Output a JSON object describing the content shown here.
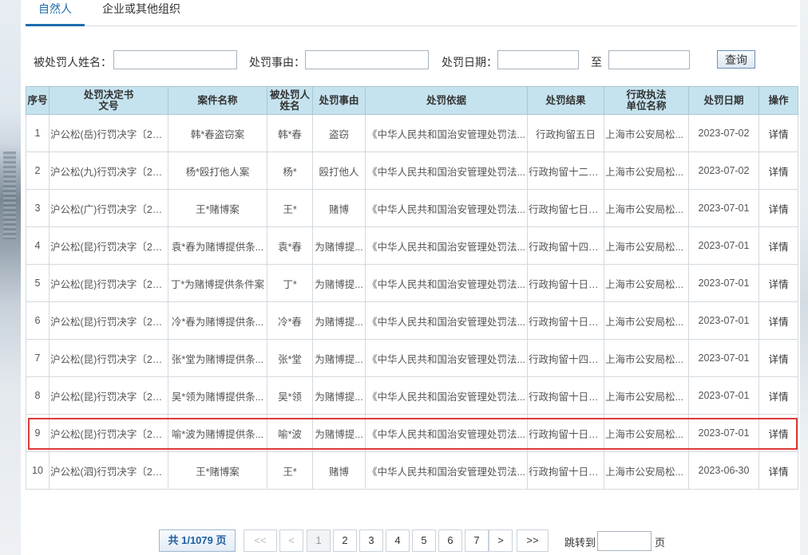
{
  "tabs": [
    {
      "label": "自然人",
      "active": true
    },
    {
      "label": "企业或其他组织",
      "active": false
    }
  ],
  "search": {
    "name_label": "被处罚人姓名：",
    "name_value": "",
    "reason_label": "处罚事由：",
    "reason_value": "",
    "date_label": "处罚日期：",
    "date_from": "",
    "to_label": "至",
    "date_to": "",
    "query_label": "查询"
  },
  "table": {
    "headers": {
      "seq": "序号",
      "doc_no_1": "处罚决定书",
      "doc_no_2": "文号",
      "case_name": "案件名称",
      "person_1": "被处罚人",
      "person_2": "姓名",
      "reason": "处罚事由",
      "basis": "处罚依据",
      "result": "处罚结果",
      "agency_1": "行政执法",
      "agency_2": "单位名称",
      "date": "处罚日期",
      "op": "操作"
    },
    "rows": [
      {
        "seq": "1",
        "doc_no": "沪公松(岳)行罚决字〔202...",
        "case_name": "韩*春盗窃案",
        "person": "韩*春",
        "reason": "盗窃",
        "basis": "《中华人民共和国治安管理处罚法...",
        "result": "行政拘留五日",
        "agency": "上海市公安局松...",
        "date": "2023-07-02",
        "op": "详情"
      },
      {
        "seq": "2",
        "doc_no": "沪公松(九)行罚决字〔202...",
        "case_name": "杨*殴打他人案",
        "person": "杨*",
        "reason": "殴打他人",
        "basis": "《中华人民共和国治安管理处罚法...",
        "result": "行政拘留十二日...",
        "agency": "上海市公安局松...",
        "date": "2023-07-02",
        "op": "详情"
      },
      {
        "seq": "3",
        "doc_no": "沪公松(广)行罚决字〔202...",
        "case_name": "王*赌博案",
        "person": "王*",
        "reason": "赌博",
        "basis": "《中华人民共和国治安管理处罚法...",
        "result": "行政拘留七日并...",
        "agency": "上海市公安局松...",
        "date": "2023-07-01",
        "op": "详情"
      },
      {
        "seq": "4",
        "doc_no": "沪公松(昆)行罚决字〔202...",
        "case_name": "袁*春为赌博提供条...",
        "person": "袁*春",
        "reason": "为赌博提...",
        "basis": "《中华人民共和国治安管理处罚法...",
        "result": "行政拘留十四日...",
        "agency": "上海市公安局松...",
        "date": "2023-07-01",
        "op": "详情"
      },
      {
        "seq": "5",
        "doc_no": "沪公松(昆)行罚决字〔202...",
        "case_name": "丁*为赌博提供条件案",
        "person": "丁*",
        "reason": "为赌博提...",
        "basis": "《中华人民共和国治安管理处罚法...",
        "result": "行政拘留十日并...",
        "agency": "上海市公安局松...",
        "date": "2023-07-01",
        "op": "详情"
      },
      {
        "seq": "6",
        "doc_no": "沪公松(昆)行罚决字〔202...",
        "case_name": "冷*春为赌博提供条...",
        "person": "冷*春",
        "reason": "为赌博提...",
        "basis": "《中华人民共和国治安管理处罚法...",
        "result": "行政拘留十日并...",
        "agency": "上海市公安局松...",
        "date": "2023-07-01",
        "op": "详情"
      },
      {
        "seq": "7",
        "doc_no": "沪公松(昆)行罚决字〔202...",
        "case_name": "张*堂为赌博提供条...",
        "person": "张*堂",
        "reason": "为赌博提...",
        "basis": "《中华人民共和国治安管理处罚法...",
        "result": "行政拘留十四日...",
        "agency": "上海市公安局松...",
        "date": "2023-07-01",
        "op": "详情"
      },
      {
        "seq": "8",
        "doc_no": "沪公松(昆)行罚决字〔202...",
        "case_name": "吴*领为赌博提供条...",
        "person": "吴*领",
        "reason": "为赌博提...",
        "basis": "《中华人民共和国治安管理处罚法...",
        "result": "行政拘留十日并...",
        "agency": "上海市公安局松...",
        "date": "2023-07-01",
        "op": "详情"
      },
      {
        "seq": "9",
        "doc_no": "沪公松(昆)行罚决字〔202...",
        "case_name": "喻*波为赌博提供条...",
        "person": "喻*波",
        "reason": "为赌博提...",
        "basis": "《中华人民共和国治安管理处罚法...",
        "result": "行政拘留十日并...",
        "agency": "上海市公安局松...",
        "date": "2023-07-01",
        "op": "详情"
      },
      {
        "seq": "10",
        "doc_no": "沪公松(泗)行罚决字〔202...",
        "case_name": "王*赌博案",
        "person": "王*",
        "reason": "赌博",
        "basis": "《中华人民共和国治安管理处罚法...",
        "result": "行政拘留十日并...",
        "agency": "上海市公安局松...",
        "date": "2023-06-30",
        "op": "详情"
      }
    ]
  },
  "highlight_color": "#e03a3a",
  "accent_color": "#1f6cb0",
  "header_bg_color": "#c5e3ee",
  "pager": {
    "total_label": "共 1/1079 页",
    "first": "<<",
    "prev": "<",
    "pages": [
      "1",
      "2",
      "3",
      "4",
      "5",
      "6",
      "7"
    ],
    "current_page": "1",
    "next": ">",
    "last": ">>",
    "jump_label": "跳转到",
    "jump_value": "",
    "page_unit": "页"
  }
}
